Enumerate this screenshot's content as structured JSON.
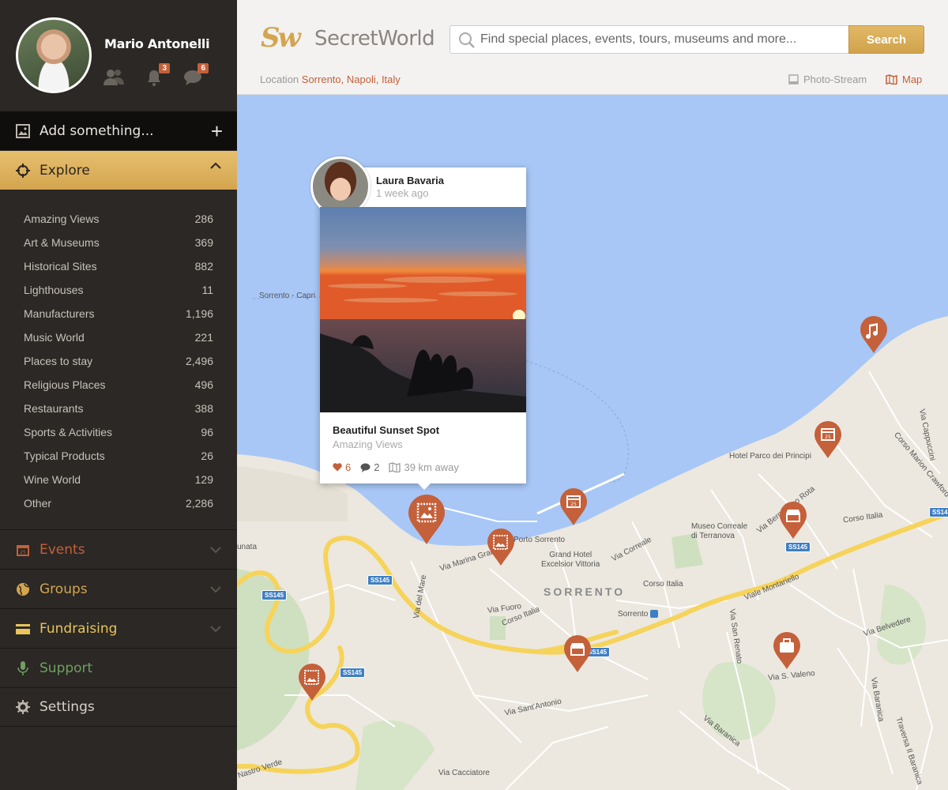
{
  "user": {
    "name": "Mario Antonelli",
    "notifications_count": "3",
    "messages_count": "6"
  },
  "sidebar": {
    "add_label": "Add something...",
    "explore_label": "Explore",
    "categories": [
      {
        "label": "Amazing Views",
        "count": "286"
      },
      {
        "label": "Art & Museums",
        "count": "369"
      },
      {
        "label": "Historical Sites",
        "count": "882"
      },
      {
        "label": "Lighthouses",
        "count": "11"
      },
      {
        "label": "Manufacturers",
        "count": "1,196"
      },
      {
        "label": "Music World",
        "count": "221"
      },
      {
        "label": "Places to stay",
        "count": "2,496"
      },
      {
        "label": "Religious Places",
        "count": "496"
      },
      {
        "label": "Restaurants",
        "count": "388"
      },
      {
        "label": "Sports & Activities",
        "count": "96"
      },
      {
        "label": "Typical Products",
        "count": "26"
      },
      {
        "label": "Wine World",
        "count": "129"
      },
      {
        "label": "Other",
        "count": "2,286"
      }
    ],
    "nav": {
      "events": "Events",
      "groups": "Groups",
      "fundraising": "Fundraising",
      "support": "Support",
      "settings": "Settings"
    }
  },
  "header": {
    "logo_mark": "Sw",
    "logo_text": "SecretWorld",
    "search_placeholder": "Find special places, events, tours, museums and more...",
    "search_button": "Search",
    "location_label": "Location",
    "location_value": "Sorrento, Napoli, Italy",
    "photo_stream_label": "Photo-Stream",
    "map_label": "Map"
  },
  "colors": {
    "accent": "#d4a54f",
    "pin": "#c4603a",
    "water": "#a8c7f6",
    "land": "#ece8df",
    "road": "#f6d35a"
  },
  "map": {
    "labels": {
      "sorrento_capri": "Sorrento - Capri",
      "hotel": "Hotel Parco dei Principi",
      "via_bernardino": "Via Bernardino Rota",
      "museo": "Museo Correale\ndi Terranova",
      "corso_italia_e": "Corso Italia",
      "porto": "Porto Sorrento",
      "grand_hotel": "Grand Hotel\nExcelsior Vittoria",
      "via_correale": "Via Correale",
      "sorrento": "SORRENTO",
      "corso_italia_c": "Corso Italia",
      "via_marina": "Via Marina Grande",
      "via_fuoro": "Via Fuoro",
      "corso_italia_w": "Corso Italia",
      "via_del_mare": "Via del Mare",
      "sorrento_station": "Sorrento",
      "viale_montariello": "Viale Montariello",
      "via_san_renato": "Via San Renato",
      "via_belvedere": "Via Belvedere",
      "via_valeno": "Via S. Valeno",
      "via_baranica": "Via Baranica",
      "via_baranica2": "Via Baranica",
      "via_sant_antonio": "Via Sant'Antonio",
      "nastro_verde": "Nastro Verde",
      "via_cacciatore": "Via Cacciatore",
      "traversa": "Traversa Il Baranica",
      "via_cappuccini": "Via Cappuccini",
      "corso_marion": "Corso Marion Crawford",
      "corso_italia_ne": "Corso Italia",
      "unata": "unata"
    },
    "road_badges": {
      "ss145_a": "SS145",
      "ss145_b": "SS145",
      "ss145_c": "SS145",
      "ss145_d": "SS145",
      "ss145_e": "SS145",
      "ss145_f": "SS145"
    }
  },
  "popup": {
    "author": "Laura Bavaria",
    "time": "1 week ago",
    "title": "Beautiful Sunset Spot",
    "category": "Amazing Views",
    "likes": "6",
    "comments": "2",
    "distance": "39 km away"
  }
}
